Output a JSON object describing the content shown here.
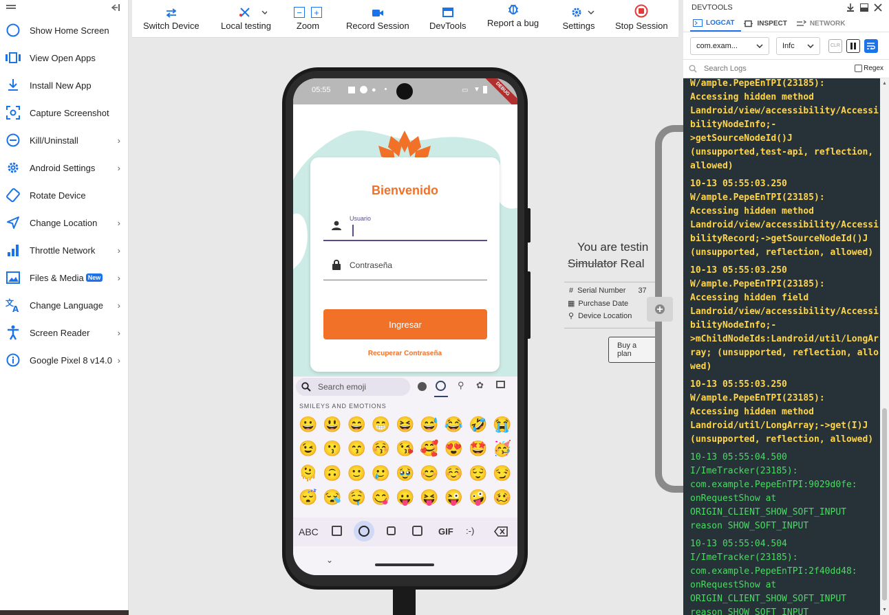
{
  "sidebar": {
    "items": [
      {
        "label": "Show Home Screen",
        "icon": "circle-icon",
        "chevron": false
      },
      {
        "label": "View Open Apps",
        "icon": "open-apps-icon",
        "chevron": false
      },
      {
        "label": "Install New App",
        "icon": "download-icon",
        "chevron": false
      },
      {
        "label": "Capture Screenshot",
        "icon": "screenshot-icon",
        "chevron": false
      },
      {
        "label": "Kill/Uninstall",
        "icon": "minus-circle-icon",
        "chevron": true
      },
      {
        "label": "Android Settings",
        "icon": "gear-icon",
        "chevron": true
      },
      {
        "label": "Rotate Device",
        "icon": "rotate-icon",
        "chevron": false
      },
      {
        "label": "Change Location",
        "icon": "location-arrow-icon",
        "chevron": true
      },
      {
        "label": "Throttle Network",
        "icon": "signal-bars-icon",
        "chevron": true
      },
      {
        "label": "Files & Media",
        "icon": "image-icon",
        "chevron": true,
        "badge": "New"
      },
      {
        "label": "Change Language",
        "icon": "translate-icon",
        "chevron": true
      },
      {
        "label": "Screen Reader",
        "icon": "accessibility-icon",
        "chevron": true
      },
      {
        "label": "Google Pixel 8  v14.0",
        "icon": "info-icon",
        "chevron": true
      }
    ]
  },
  "toolbar": {
    "switch_device": "Switch Device",
    "local_testing": "Local testing",
    "zoom": "Zoom",
    "record_session": "Record Session",
    "devtools": "DevTools",
    "report_bug": "Report a bug",
    "settings": "Settings",
    "stop_session": "Stop Session"
  },
  "phone": {
    "time": "05:55",
    "debug": "DEBUG",
    "app": {
      "title": "Bienvenido",
      "user_label": "Usuario",
      "password_placeholder": "Contraseña",
      "login_button": "Ingresar",
      "recover_link": "Recuperar Contraseña"
    },
    "keyboard": {
      "search_placeholder": "Search emoji",
      "section_title": "SMILEYS AND EMOTIONS",
      "emojis": [
        "😀",
        "😃",
        "😄",
        "😁",
        "😆",
        "😅",
        "😂",
        "🤣",
        "😭",
        "😉",
        "😗",
        "😙",
        "😚",
        "😘",
        "🥰",
        "😍",
        "🤩",
        "🥳",
        "🫠",
        "🙃",
        "🙂",
        "🥲",
        "🥹",
        "😊",
        "☺️",
        "😌",
        "😏",
        "😴",
        "😪",
        "🤤",
        "😋",
        "😛",
        "😝",
        "😜",
        "🤪",
        "🥴"
      ],
      "abc_label": "ABC",
      "gif_label": "GIF",
      "emoticon_label": ":-)"
    }
  },
  "device_info": {
    "headline": "You are testin",
    "strike_text": "Simulator",
    "real_text": "Real",
    "serial_label": "Serial Number",
    "serial_value": "37",
    "purchase_label": "Purchase Date",
    "location_label": "Device Location",
    "buy_button": "Buy a plan"
  },
  "devtools": {
    "title": "DEVTOOLS",
    "tabs": [
      "LOGCAT",
      "INSPECT",
      "NETWORK"
    ],
    "package_select": "com.exam...",
    "level_select": "Infc",
    "clr_label": "CLR",
    "search_placeholder": "Search Logs",
    "regex_label": "Regex",
    "logs": [
      {
        "level": "w",
        "text": "W/ample.PepeEnTPI(23185):\nAccessing hidden method\nLandroid/view/accessibility/AccessibilityNodeInfo;-\n>getSourceNodeId()J\n(unsupported,test-api, reflection, allowed)"
      },
      {
        "level": "w",
        "text": "10-13 05:55:03.250\nW/ample.PepeEnTPI(23185):\nAccessing hidden method\nLandroid/view/accessibility/AccessibilityRecord;->getSourceNodeId()J\n(unsupported, reflection, allowed)"
      },
      {
        "level": "w",
        "text": "10-13 05:55:03.250\nW/ample.PepeEnTPI(23185):\nAccessing hidden field\nLandroid/view/accessibility/AccessibilityNodeInfo;-\n>mChildNodeIds:Landroid/util/LongArray; (unsupported, reflection, allowed)"
      },
      {
        "level": "w",
        "text": "10-13 05:55:03.250\nW/ample.PepeEnTPI(23185):\nAccessing hidden method\nLandroid/util/LongArray;->get(I)J\n(unsupported, reflection, allowed)"
      },
      {
        "level": "i",
        "text": "10-13 05:55:04.500\nI/ImeTracker(23185):\ncom.example.PepeEnTPI:9029d0fe:\nonRequestShow at\nORIGIN_CLIENT_SHOW_SOFT_INPUT\nreason SHOW_SOFT_INPUT"
      },
      {
        "level": "i",
        "text": "10-13 05:55:04.504\nI/ImeTracker(23185):\ncom.example.PepeEnTPI:2f40dd48:\nonRequestShow at\nORIGIN_CLIENT_SHOW_SOFT_INPUT\nreason SHOW_SOFT_INPUT"
      }
    ]
  },
  "colors": {
    "accent": "#1a73e8",
    "brand_orange": "#f07127",
    "stop_red": "#e53935",
    "log_bg": "#263238",
    "log_warn": "#ffd54a",
    "log_info": "#4cd964"
  }
}
